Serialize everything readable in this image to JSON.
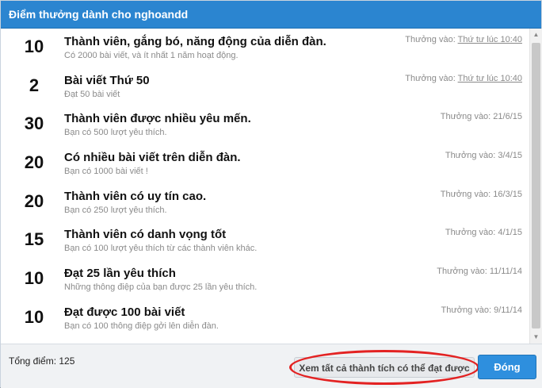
{
  "dialog": {
    "title": "Điểm thưởng dành cho nghoandd"
  },
  "awards": [
    {
      "points": "10",
      "title": "Thành viên, gắng bó, năng động của diễn đàn.",
      "desc": "Có 2000 bài viết, và ít nhất 1 năm hoạt động.",
      "date_label": "Thưởng vào:",
      "date": "Thứ tư lúc 10:40",
      "date_underlined": true
    },
    {
      "points": "2",
      "title": "Bài viết Thứ 50",
      "desc": "Đạt 50 bài viết",
      "date_label": "Thưởng vào:",
      "date": "Thứ tư lúc 10:40",
      "date_underlined": true
    },
    {
      "points": "30",
      "title": "Thành viên được nhiều yêu mến.",
      "desc": "Bạn có 500 lượt yêu thích.",
      "date_label": "Thưởng vào:",
      "date": "21/6/15",
      "date_underlined": false
    },
    {
      "points": "20",
      "title": "Có nhiều bài viết trên diễn đàn.",
      "desc": "Bạn có 1000 bài viết !",
      "date_label": "Thưởng vào:",
      "date": "3/4/15",
      "date_underlined": false
    },
    {
      "points": "20",
      "title": "Thành viên có uy tín cao.",
      "desc": "Bạn có 250 lượt yêu thích.",
      "date_label": "Thưởng vào:",
      "date": "16/3/15",
      "date_underlined": false
    },
    {
      "points": "15",
      "title": "Thành viên có danh vọng tốt",
      "desc": "Bạn có 100 lượt yêu thích từ các thành viên khác.",
      "date_label": "Thưởng vào:",
      "date": "4/1/15",
      "date_underlined": false
    },
    {
      "points": "10",
      "title": "Đạt 25 lần yêu thích",
      "desc": "Những thông điệp của bạn được 25 lần yêu thích.",
      "date_label": "Thưởng vào:",
      "date": "11/11/14",
      "date_underlined": false
    },
    {
      "points": "10",
      "title": "Đạt được 100 bài viết",
      "desc": "Bạn có 100 thông điệp gởi lên diễn đàn.",
      "date_label": "Thưởng vào:",
      "date": "9/11/14",
      "date_underlined": false
    }
  ],
  "footer": {
    "total_label": "Tổng điểm: 125",
    "view_all_label": "Xem tất cả thành tích có thể đạt được",
    "close_label": "Đóng"
  },
  "colors": {
    "titlebar": "#2b85d0",
    "close_button": "#2e8fde",
    "highlight_ellipse": "#e32222"
  }
}
